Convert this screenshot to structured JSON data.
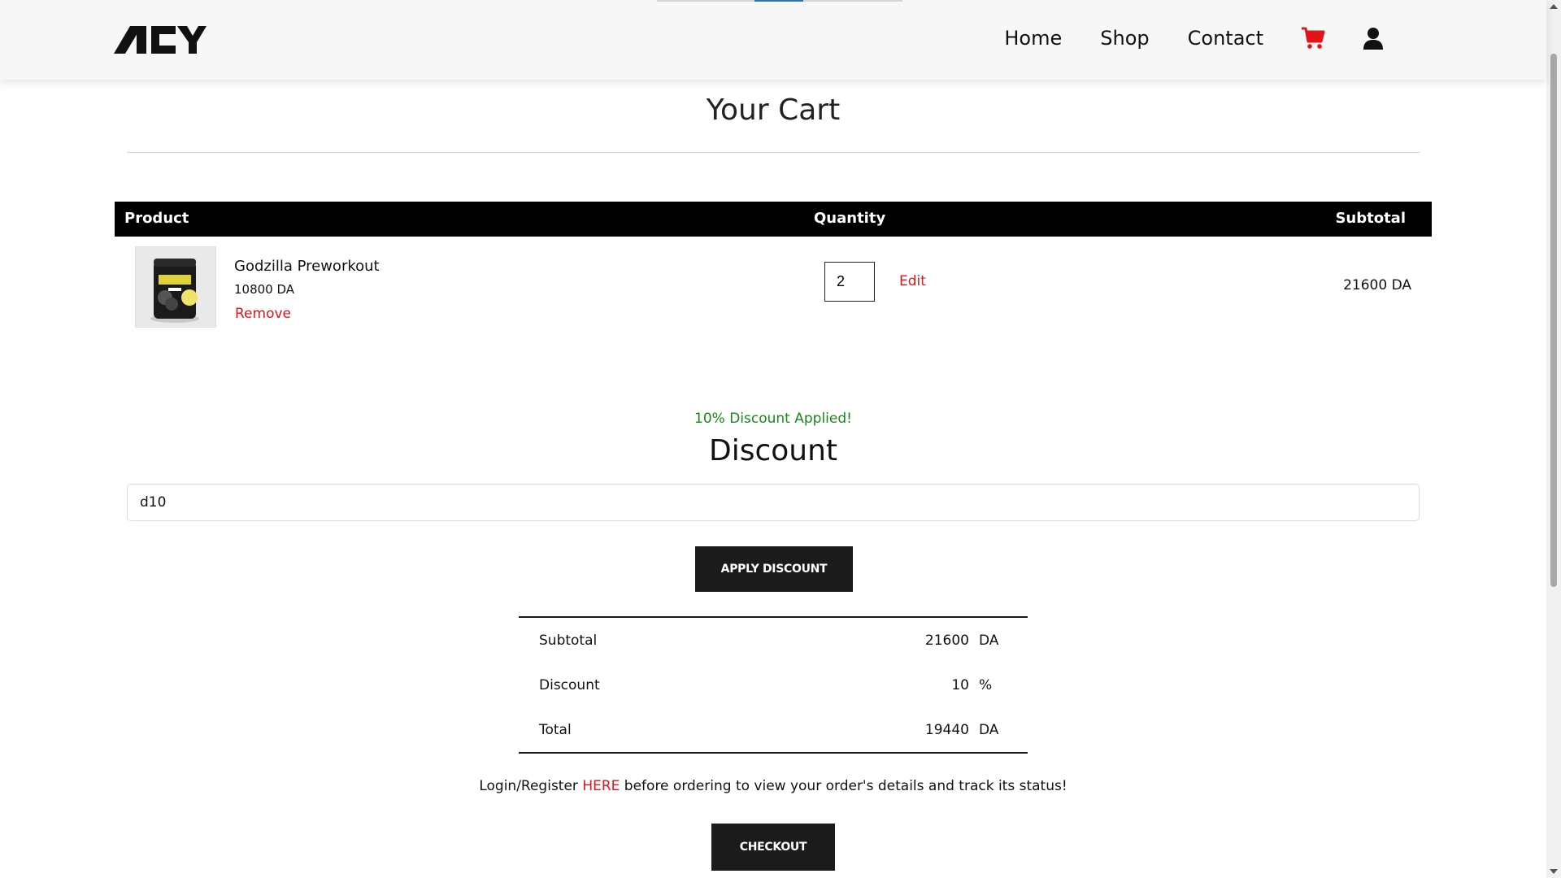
{
  "brand": {
    "logo_text": "ACY"
  },
  "nav": {
    "links": [
      "Home",
      "Shop",
      "Contact"
    ],
    "cart_icon": "cart-icon",
    "user_icon": "user-icon",
    "accent_color": "#e1141c"
  },
  "page": {
    "title": "Your Cart"
  },
  "cart": {
    "headers": {
      "product": "Product",
      "quantity": "Quantity",
      "subtotal": "Subtotal"
    },
    "items": [
      {
        "name": "Godzilla Preworkout",
        "price": "10800 DA",
        "remove_label": "Remove",
        "quantity": "2",
        "edit_label": "Edit",
        "subtotal": "21600 DA"
      }
    ]
  },
  "discount": {
    "message": "10% Discount Applied!",
    "message_color": "#168a16",
    "title": "Discount",
    "code_value": "d10",
    "apply_label": "APPLY DISCOUNT"
  },
  "totals": {
    "rows": [
      {
        "label": "Subtotal",
        "value": "21600",
        "unit": "DA"
      },
      {
        "label": "Discount",
        "value": "10",
        "unit": "%"
      },
      {
        "label": "Total",
        "value": "19440",
        "unit": "DA"
      }
    ]
  },
  "login_note": {
    "before": "Login/Register ",
    "link": "HERE",
    "after": " before ordering to view your order's details and track its status!"
  },
  "checkout": {
    "label": "CHECKOUT"
  }
}
